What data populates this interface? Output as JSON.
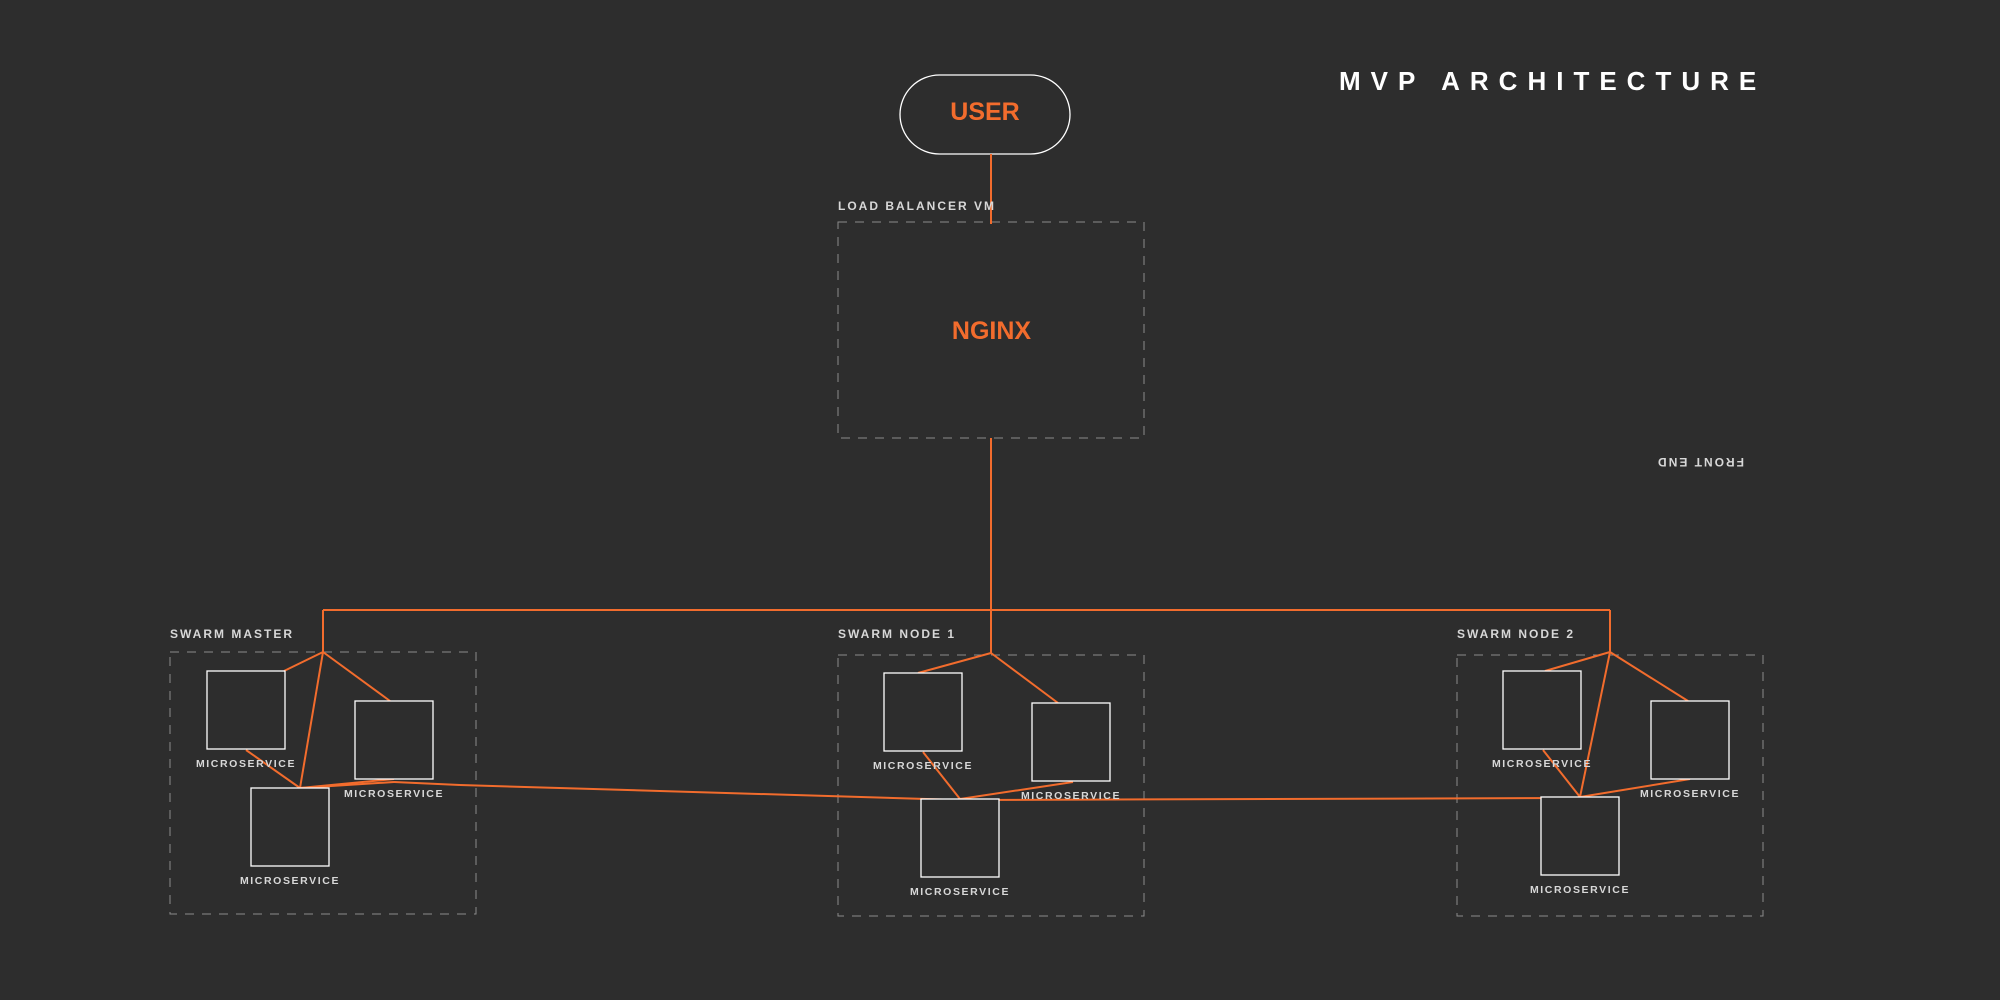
{
  "title": "MVP ARCHITECTURE",
  "mirrored_label": "FRONT END",
  "user": {
    "label": "USER"
  },
  "load_balancer": {
    "label": "LOAD BALANCER VM",
    "service": "NGINX"
  },
  "swarm_master": {
    "label": "SWARM MASTER",
    "microservices": [
      "MICROSERVICE",
      "MICROSERVICE",
      "MICROSERVICE"
    ]
  },
  "swarm_node_1": {
    "label": "SWARM NODE 1",
    "microservices": [
      "MICROSERVICE",
      "MICROSERVICE",
      "MICROSERVICE"
    ]
  },
  "swarm_node_2": {
    "label": "SWARM NODE 2",
    "microservices": [
      "MICROSERVICE",
      "MICROSERVICE",
      "MICROSERVICE"
    ]
  },
  "colors": {
    "background": "#2d2d2d",
    "accent": "#f26c2d",
    "box_stroke": "#ffffff",
    "dashed_stroke": "#8a8a8a",
    "text": "#d8d8d8"
  }
}
